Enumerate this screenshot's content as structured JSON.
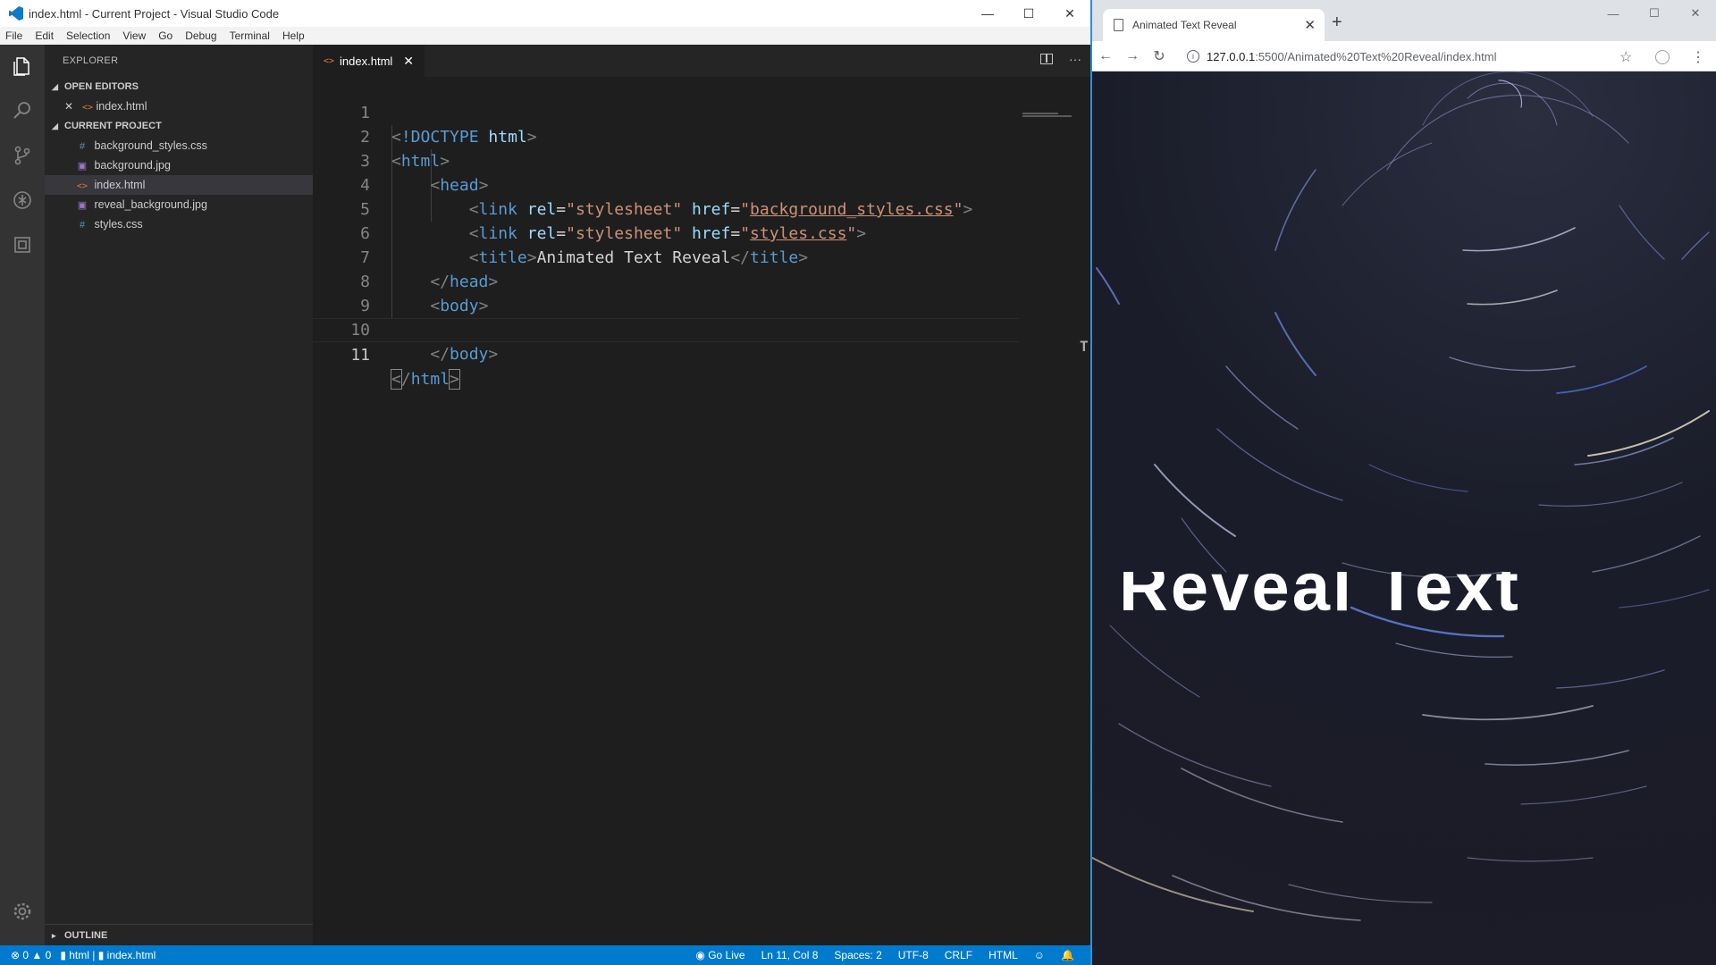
{
  "vscode": {
    "window_title": "index.html - Current Project - Visual Studio Code",
    "menu": [
      "File",
      "Edit",
      "Selection",
      "View",
      "Go",
      "Debug",
      "Terminal",
      "Help"
    ],
    "sidebar": {
      "title": "EXPLORER",
      "open_editors_label": "OPEN EDITORS",
      "open_editors": [
        {
          "name": "index.html",
          "icon": "html-file-icon"
        }
      ],
      "project_label": "CURRENT PROJECT",
      "files": [
        {
          "name": "background_styles.css",
          "icon": "css-file-icon"
        },
        {
          "name": "background.jpg",
          "icon": "image-file-icon"
        },
        {
          "name": "index.html",
          "icon": "html-file-icon",
          "selected": true
        },
        {
          "name": "reveal_background.jpg",
          "icon": "image-file-icon"
        },
        {
          "name": "styles.css",
          "icon": "css-file-icon"
        }
      ],
      "outline_label": "OUTLINE"
    },
    "tab": {
      "label": "index.html"
    },
    "code_lines": [
      "1",
      "2",
      "3",
      "4",
      "5",
      "6",
      "7",
      "8",
      "9",
      "10",
      "11"
    ],
    "code": {
      "l1_doctype": "!DOCTYPE",
      "l1_html": "html",
      "tag_html": "html",
      "tag_head": "head",
      "tag_link": "link",
      "attr_rel": "rel",
      "val_stylesheet": "\"stylesheet\"",
      "attr_href": "href",
      "val_bg_css": "background_styles.css",
      "val_styles_css": "styles.css",
      "tag_title": "title",
      "title_text": "Animated Text Reveal",
      "tag_body": "body"
    },
    "statusbar": {
      "errors": "0",
      "warnings": "0",
      "breadcrumb_lang": "html",
      "breadcrumb_file": "index.html",
      "go_live": "Go Live",
      "position": "Ln 11, Col 8",
      "spaces": "Spaces: 2",
      "encoding": "UTF-8",
      "eol": "CRLF",
      "language": "HTML"
    },
    "colors": {
      "statusbar": "#007acc",
      "activitybar": "#333333",
      "sidebar": "#252526",
      "editor": "#1e1e1e"
    }
  },
  "chrome": {
    "tab_title": "Animated Text Reveal",
    "url_host": "127.0.0.1",
    "url_path": ":5500/Animated%20Text%20Reveal/index.html",
    "page_text": "Reveal Text"
  }
}
